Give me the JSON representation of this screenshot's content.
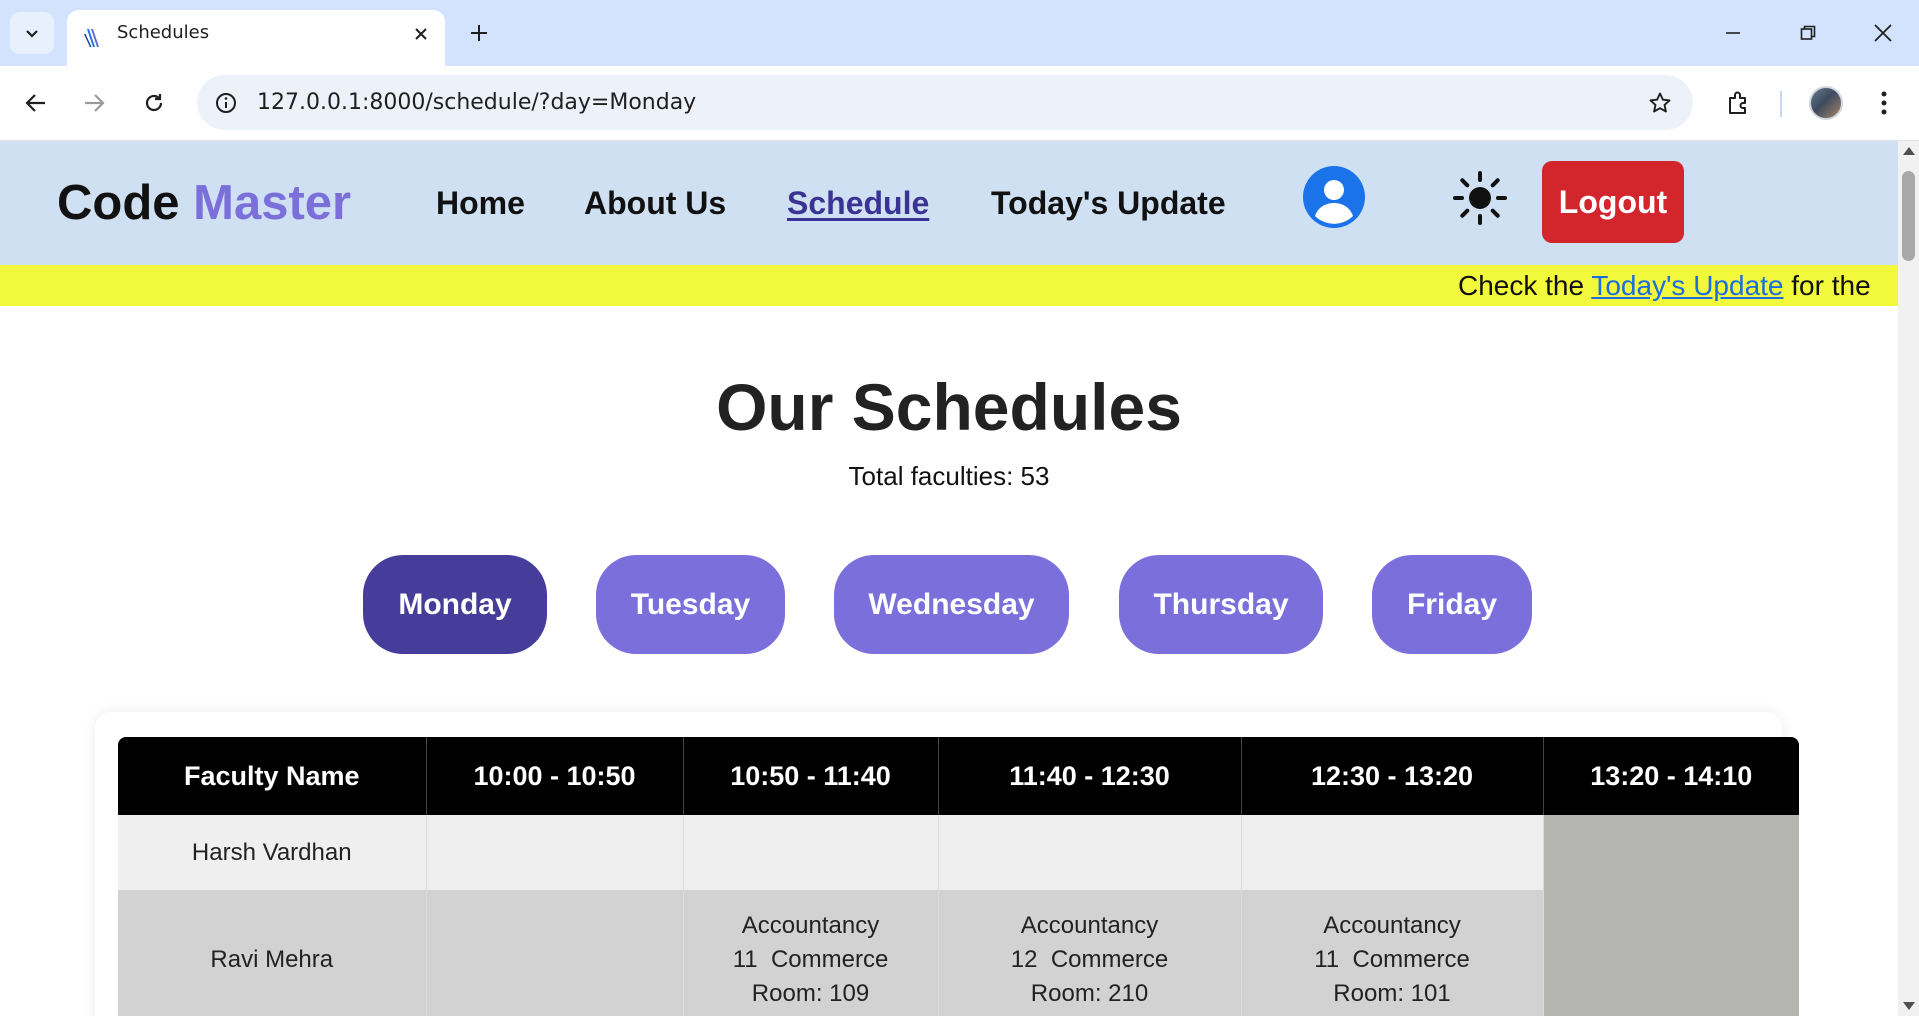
{
  "browser": {
    "tab_title": "Schedules",
    "url": "127.0.0.1:8000/schedule/?day=Monday"
  },
  "site": {
    "logo_main": "Code",
    "logo_accent": "Master",
    "nav": [
      "Home",
      "About Us",
      "Schedule",
      "Today's Update"
    ],
    "active_nav": "Schedule",
    "logout_label": "Logout",
    "accent_color": "#7b6fd9"
  },
  "ticker": {
    "prefix": "Check the",
    "link": "Today's Update",
    "suffix": "for the"
  },
  "page": {
    "title": "Our Schedules",
    "total": "Total faculties: 53"
  },
  "days": [
    "Monday",
    "Tuesday",
    "Wednesday",
    "Thursday",
    "Friday"
  ],
  "active_day": "Monday",
  "table": {
    "headers": [
      "Faculty Name",
      "10:00 - 10:50",
      "10:50 - 11:40",
      "11:40 - 12:30",
      "12:30 - 13:20",
      "13:20 - 14:10"
    ],
    "rows": [
      {
        "name": "Harsh Vardhan",
        "cells": [
          [],
          [],
          [],
          []
        ]
      },
      {
        "name": "Ravi Mehra",
        "cells": [
          [],
          [
            "Accountancy",
            "11  Commerce",
            "Room: 109"
          ],
          [
            "Accountancy",
            "12  Commerce",
            "Room: 210"
          ],
          [
            "Accountancy",
            "11  Commerce",
            "Room: 101"
          ]
        ]
      }
    ]
  }
}
